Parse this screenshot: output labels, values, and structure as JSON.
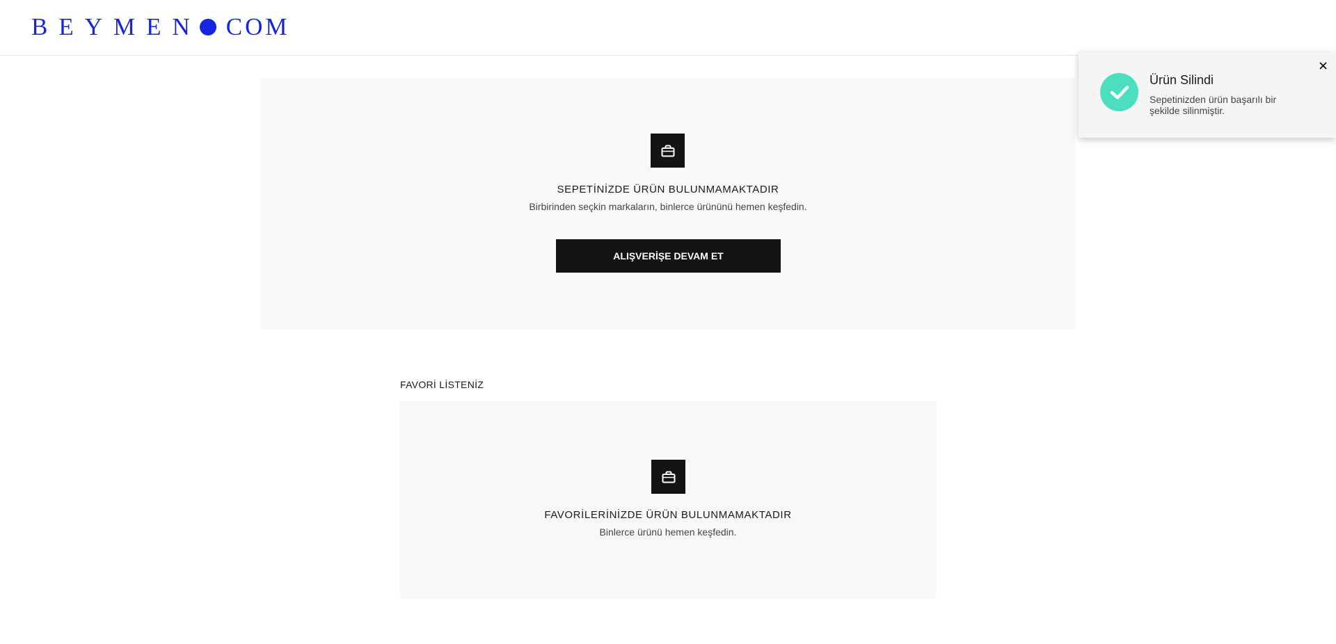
{
  "header": {
    "logo_left": "BEYMEN",
    "logo_right": "COM",
    "brand_color": "#1426e0"
  },
  "cart": {
    "icon": "shopping-bag-icon",
    "empty_title": "SEPETİNİZDE ÜRÜN BULUNMAMAKTADIR",
    "empty_subtitle": "Birbirinden seçkin markaların, binlerce ürününü hemen keşfedin.",
    "cta_label": "ALIŞVERİŞE DEVAM ET"
  },
  "favorites": {
    "title": "FAVORİ LİSTENİZ",
    "icon": "shopping-bag-icon",
    "empty_title": "FAVORİLERİNİZDE ÜRÜN BULUNMAMAKTADIR",
    "empty_subtitle": "Binlerce ürünü hemen keşfedin."
  },
  "toast": {
    "icon": "check-icon",
    "icon_color": "#4cdfbf",
    "title": "Ürün Silindi",
    "message": "Sepetinizden ürün başarılı bir şekilde silinmiştir.",
    "close_icon": "close-icon"
  }
}
